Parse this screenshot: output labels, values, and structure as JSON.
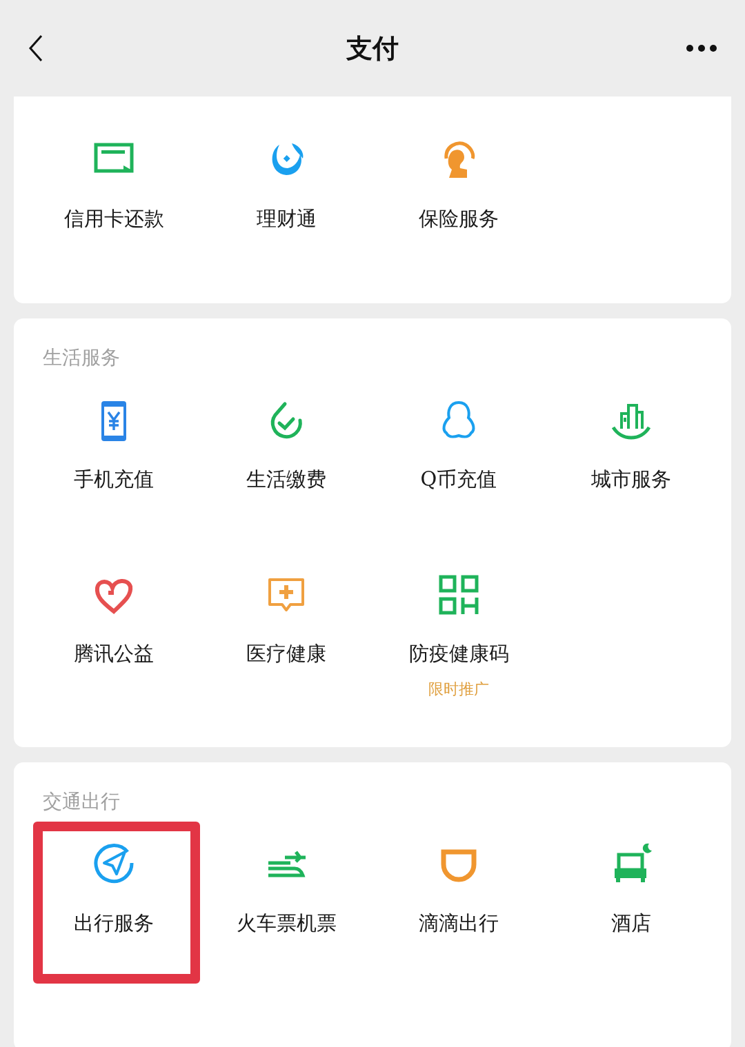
{
  "header": {
    "title": "支付"
  },
  "sections": [
    {
      "items": [
        {
          "label": "信用卡还款",
          "highlighted": false
        },
        {
          "label": "理财通",
          "highlighted": false
        },
        {
          "label": "保险服务",
          "highlighted": false
        }
      ]
    },
    {
      "title": "生活服务",
      "items": [
        {
          "label": "手机充值",
          "highlighted": false
        },
        {
          "label": "生活缴费",
          "highlighted": false
        },
        {
          "label": "Q币充值",
          "highlighted": false
        },
        {
          "label": "城市服务",
          "highlighted": false
        },
        {
          "label": "腾讯公益",
          "highlighted": false
        },
        {
          "label": "医疗健康",
          "highlighted": false
        },
        {
          "label": "防疫健康码",
          "sublabel": "限时推广",
          "highlighted": false
        }
      ]
    },
    {
      "title": "交通出行",
      "items": [
        {
          "label": "出行服务",
          "highlighted": true
        },
        {
          "label": "火车票机票",
          "highlighted": false
        },
        {
          "label": "滴滴出行",
          "highlighted": false
        },
        {
          "label": "酒店",
          "highlighted": false
        }
      ]
    }
  ]
}
